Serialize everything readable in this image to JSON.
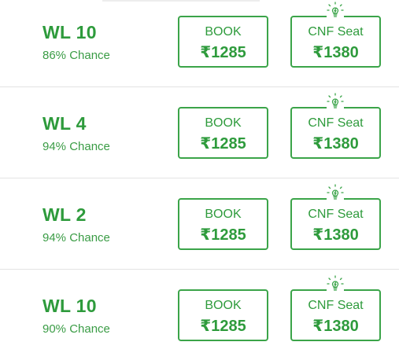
{
  "rows": [
    {
      "waitlist": "WL 10",
      "chance": "86% Chance",
      "book_label": "BOOK",
      "book_price": "₹1285",
      "cnf_label": "CNF Seat",
      "cnf_price": "₹1380"
    },
    {
      "waitlist": "WL 4",
      "chance": "94% Chance",
      "book_label": "BOOK",
      "book_price": "₹1285",
      "cnf_label": "CNF Seat",
      "cnf_price": "₹1380"
    },
    {
      "waitlist": "WL 2",
      "chance": "94% Chance",
      "book_label": "BOOK",
      "book_price": "₹1285",
      "cnf_label": "CNF Seat",
      "cnf_price": "₹1380"
    },
    {
      "waitlist": "WL 10",
      "chance": "90% Chance",
      "book_label": "BOOK",
      "book_price": "₹1285",
      "cnf_label": "CNF Seat",
      "cnf_price": "₹1380"
    }
  ],
  "colors": {
    "accent": "#2e9b3c",
    "border": "#3ba449",
    "divider": "#e3e3e3"
  },
  "icons": {
    "cnf_badge": "lightbulb-icon"
  }
}
